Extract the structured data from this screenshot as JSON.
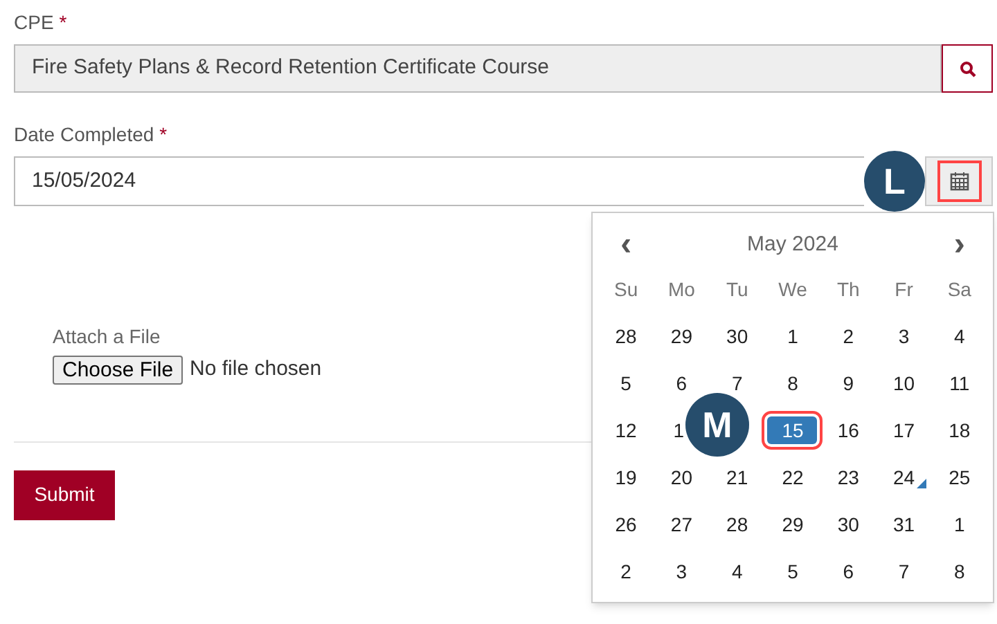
{
  "cpe": {
    "label": "CPE",
    "required_mark": "*",
    "value": "Fire Safety Plans & Record Retention Certificate Course"
  },
  "date_completed": {
    "label": "Date Completed",
    "required_mark": "*",
    "value": "15/05/2024"
  },
  "calendar": {
    "prev": "‹",
    "title": "May 2024",
    "next": "›",
    "weekdays": [
      "Su",
      "Mo",
      "Tu",
      "We",
      "Th",
      "Fr",
      "Sa"
    ],
    "days": [
      {
        "text": "28",
        "selected": false,
        "today": false
      },
      {
        "text": "29",
        "selected": false,
        "today": false
      },
      {
        "text": "30",
        "selected": false,
        "today": false
      },
      {
        "text": "1",
        "selected": false,
        "today": false
      },
      {
        "text": "2",
        "selected": false,
        "today": false
      },
      {
        "text": "3",
        "selected": false,
        "today": false
      },
      {
        "text": "4",
        "selected": false,
        "today": false
      },
      {
        "text": "5",
        "selected": false,
        "today": false
      },
      {
        "text": "6",
        "selected": false,
        "today": false
      },
      {
        "text": "7",
        "selected": false,
        "today": false
      },
      {
        "text": "8",
        "selected": false,
        "today": false
      },
      {
        "text": "9",
        "selected": false,
        "today": false
      },
      {
        "text": "10",
        "selected": false,
        "today": false
      },
      {
        "text": "11",
        "selected": false,
        "today": false
      },
      {
        "text": "12",
        "selected": false,
        "today": false
      },
      {
        "kind": "clipped",
        "text": "1",
        "selected": false,
        "today": false
      },
      {
        "kind": "covered"
      },
      {
        "text": "15",
        "selected": true,
        "today": false
      },
      {
        "text": "16",
        "selected": false,
        "today": false
      },
      {
        "text": "17",
        "selected": false,
        "today": false
      },
      {
        "text": "18",
        "selected": false,
        "today": false
      },
      {
        "text": "19",
        "selected": false,
        "today": false
      },
      {
        "text": "20",
        "selected": false,
        "today": false
      },
      {
        "text": "21",
        "selected": false,
        "today": false
      },
      {
        "text": "22",
        "selected": false,
        "today": false
      },
      {
        "text": "23",
        "selected": false,
        "today": false
      },
      {
        "text": "24",
        "selected": false,
        "today": true
      },
      {
        "text": "25",
        "selected": false,
        "today": false
      },
      {
        "text": "26",
        "selected": false,
        "today": false
      },
      {
        "text": "27",
        "selected": false,
        "today": false
      },
      {
        "text": "28",
        "selected": false,
        "today": false
      },
      {
        "text": "29",
        "selected": false,
        "today": false
      },
      {
        "text": "30",
        "selected": false,
        "today": false
      },
      {
        "text": "31",
        "selected": false,
        "today": false
      },
      {
        "text": "1",
        "selected": false,
        "today": false
      },
      {
        "text": "2",
        "selected": false,
        "today": false
      },
      {
        "text": "3",
        "selected": false,
        "today": false
      },
      {
        "text": "4",
        "selected": false,
        "today": false
      },
      {
        "text": "5",
        "selected": false,
        "today": false
      },
      {
        "text": "6",
        "selected": false,
        "today": false
      },
      {
        "text": "7",
        "selected": false,
        "today": false
      },
      {
        "text": "8",
        "selected": false,
        "today": false
      }
    ]
  },
  "attach": {
    "label": "Attach a File",
    "button": "Choose File",
    "status": "No file chosen"
  },
  "submit": "Submit",
  "annotations": [
    {
      "label": "L"
    },
    {
      "label": "M"
    }
  ]
}
